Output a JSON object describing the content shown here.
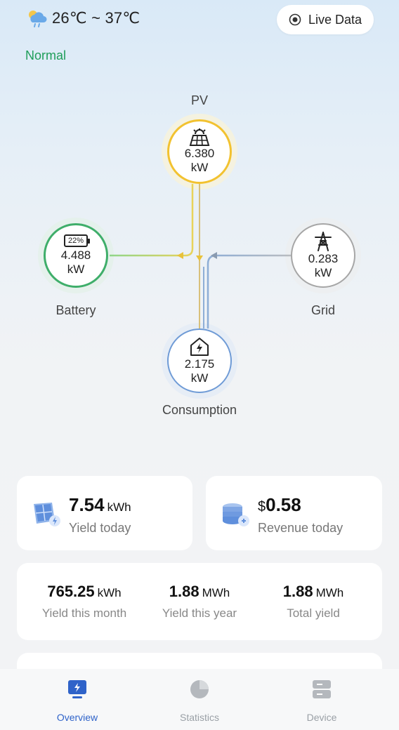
{
  "weather": {
    "icon": "partly-cloudy-rain-icon",
    "temp_range": "26℃ ~ 37℃"
  },
  "live_button": {
    "label": "Live Data",
    "icon": "target-icon"
  },
  "status": {
    "text": "Normal",
    "color": "#1f9e5a"
  },
  "flow": {
    "pv": {
      "label": "PV",
      "value": "6.380",
      "unit": "kW",
      "icon": "solar-panel-icon",
      "color": "#f2c230"
    },
    "battery": {
      "label": "Battery",
      "value": "4.488",
      "unit": "kW",
      "level": "22%",
      "icon": "battery-icon",
      "color": "#3fae6a"
    },
    "grid": {
      "label": "Grid",
      "value": "0.283",
      "unit": "kW",
      "icon": "power-tower-icon",
      "color": "#9a9a9a"
    },
    "consumption": {
      "label": "Consumption",
      "value": "2.175",
      "unit": "kW",
      "icon": "house-bolt-icon",
      "color": "#6f9bd6"
    }
  },
  "cards": {
    "yield_today": {
      "value": "7.54",
      "unit": "kWh",
      "label": "Yield today",
      "icon": "solar-panel-icon"
    },
    "revenue_today": {
      "currency": "$",
      "value": "0.58",
      "label": "Revenue today",
      "icon": "coins-icon"
    }
  },
  "stats": [
    {
      "value": "765.25",
      "unit": "kWh",
      "label": "Yield this month"
    },
    {
      "value": "1.88",
      "unit": "MWh",
      "label": "Yield this year"
    },
    {
      "value": "1.88",
      "unit": "MWh",
      "label": "Total yield"
    }
  ],
  "tabs": [
    {
      "label": "Overview",
      "icon": "monitor-bolt-icon",
      "active": true
    },
    {
      "label": "Statistics",
      "icon": "pie-chart-icon",
      "active": false
    },
    {
      "label": "Device",
      "icon": "server-icon",
      "active": false
    }
  ],
  "colors": {
    "accent": "#2f63c9",
    "tab_inactive": "#9aa0a6"
  }
}
